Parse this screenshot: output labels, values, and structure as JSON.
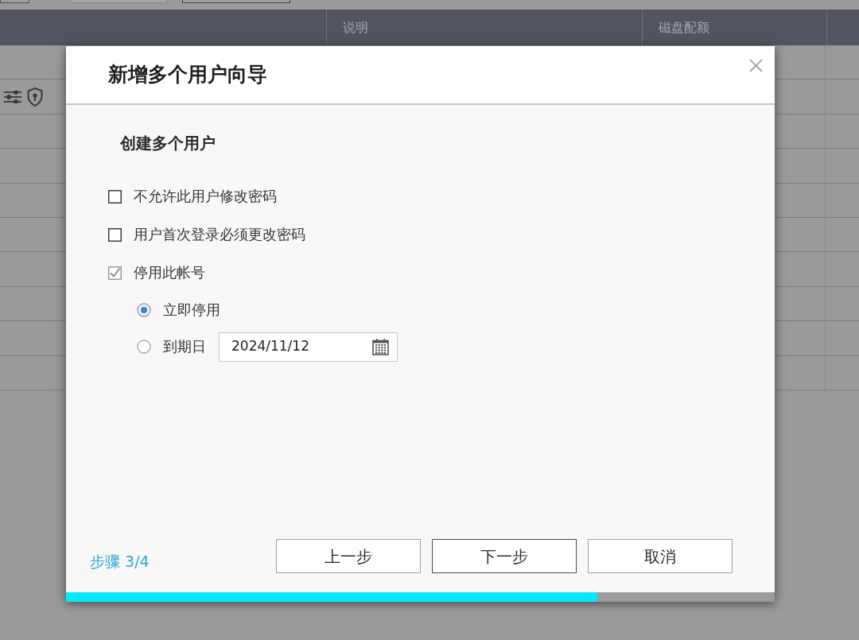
{
  "table": {
    "header_cells": [
      "说明",
      "磁盘配额"
    ]
  },
  "dialog": {
    "title": "新增多个用户向导",
    "section_title": "创建多个用户",
    "options": [
      {
        "kind": "checkbox",
        "label": "不允许此用户修改密码",
        "checked": false
      },
      {
        "kind": "checkbox",
        "label": "用户首次登录必须更改密码",
        "checked": false
      },
      {
        "kind": "checkbox",
        "label": "停用此帐号",
        "checked": true,
        "children": [
          {
            "kind": "radio",
            "label": "立即停用",
            "selected": true
          },
          {
            "kind": "radio",
            "label": "到期日",
            "selected": false,
            "date_field": {
              "value": "2024/11/12"
            }
          }
        ]
      }
    ],
    "step": "步骤 3/4",
    "buttons": [
      {
        "label": "上一步",
        "focused": false
      },
      {
        "label": "下一步",
        "focused": true
      },
      {
        "label": "取消",
        "focused": false
      }
    ],
    "progress": {
      "level": 0.75
    }
  }
}
